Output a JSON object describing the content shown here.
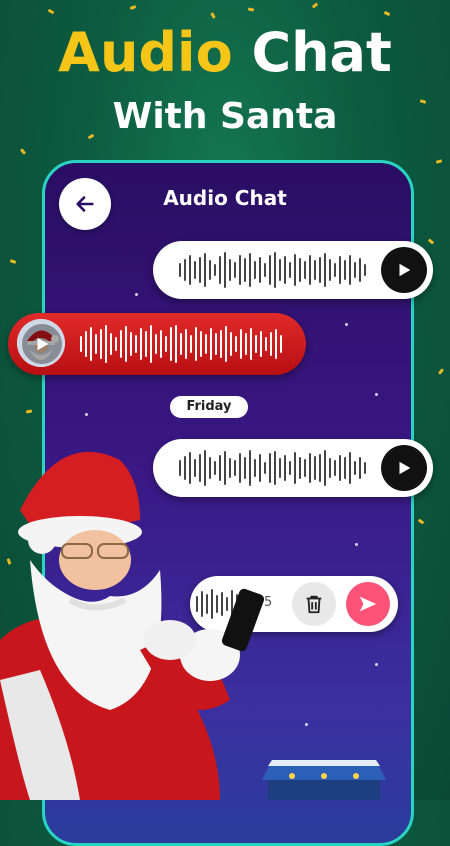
{
  "banner": {
    "headline_part1": "Audio",
    "headline_part2": "Chat",
    "subheadline": "With Santa"
  },
  "screen": {
    "title": "Audio Chat",
    "back_icon": "arrow-left-icon",
    "day_separator": "Friday",
    "recorder_timer": "5"
  },
  "colors": {
    "background": "#0d5c41",
    "headline_accent": "#f5c518",
    "phone_border": "#2ad3c2",
    "santa_bubble": "#d41e22",
    "send_button": "#ff5277"
  }
}
